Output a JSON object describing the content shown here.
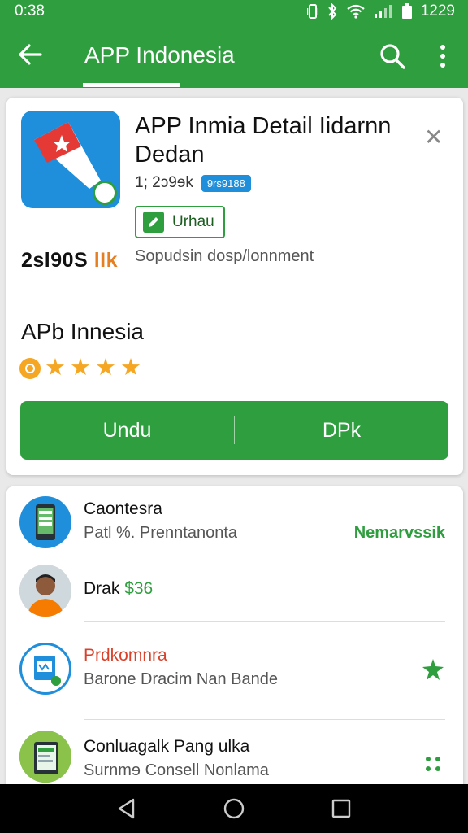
{
  "status_bar": {
    "time": "0:38",
    "clock": "1229"
  },
  "app_bar": {
    "title": "APP Indonesia"
  },
  "detail": {
    "title": "APP Inmia Detail Iidarnn Dedan",
    "meta_text": "1; 2ɔ9ɘk",
    "meta_chip": "9rs9188",
    "edit_label": "Urhau",
    "price_main": "2sl90S",
    "price_suffix": "lIk",
    "description": "Sopudsin dosp/lonnment",
    "app_name": "APb Innesia",
    "rating": 4,
    "btn_left": "Undu",
    "btn_right": "DPk"
  },
  "list": [
    {
      "title": "Caontesra",
      "subtitle": "Patl %. Prenntanonta",
      "right_label": "Nemarvssik",
      "icon": "phone-icon"
    },
    {
      "title": "Drak",
      "price": "$36",
      "icon": "person-avatar"
    },
    {
      "title": "Prdkomnra",
      "subtitle": "Barone Dracim Nan Bande",
      "icon": "document-icon",
      "right_icon": "pin-icon"
    },
    {
      "title": "Conluagalk Pang ulka",
      "subtitle": "Surnmɘ Consell Nonlama",
      "icon": "tablet-icon",
      "right_icon": "dots-icon"
    }
  ],
  "colors": {
    "primary": "#2e9e3e",
    "accent_blue": "#1f8fdc",
    "star": "#f5a623",
    "red_title": "#d9412b"
  }
}
